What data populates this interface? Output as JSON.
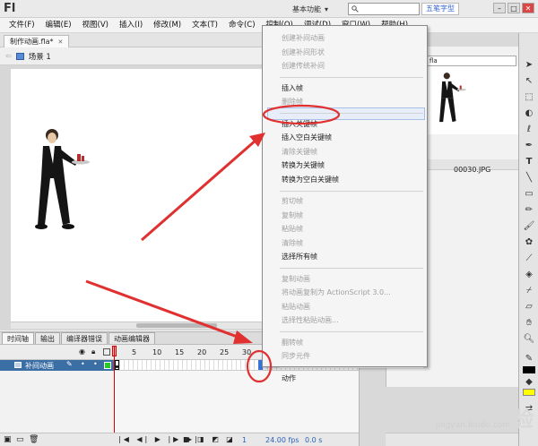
{
  "app": {
    "logo": "Fl"
  },
  "titlebar": {
    "workspace": "基本功能",
    "search_placeholder": "",
    "extra_label": "五笔字型"
  },
  "menu": [
    "文件(F)",
    "编辑(E)",
    "视图(V)",
    "插入(I)",
    "修改(M)",
    "文本(T)",
    "命令(C)",
    "控制(O)",
    "调试(D)",
    "窗口(W)",
    "帮助(H)"
  ],
  "document": {
    "tab_title": "制作动画.fla*",
    "scene": "场景 1"
  },
  "timeline": {
    "tabs": [
      "时间轴",
      "输出",
      "编译器错误",
      "动画编辑器"
    ],
    "layer_name": "补间动画",
    "frame_numbers": [
      "5",
      "10",
      "15",
      "20",
      "25",
      "30"
    ],
    "current_frame": "1",
    "fps": "24.00 fps",
    "time": "0.0 s"
  },
  "library": {
    "dropdown": "fla",
    "item": "00030.JPG"
  },
  "context_menu": {
    "groups": [
      [
        {
          "label": "创建补间动画",
          "enabled": false
        },
        {
          "label": "创建补间形状",
          "enabled": false
        },
        {
          "label": "创建传统补间",
          "enabled": false
        }
      ],
      [
        {
          "label": "插入帧",
          "enabled": true
        },
        {
          "label": "删除帧",
          "enabled": false
        }
      ],
      [
        {
          "label": "插入关键帧",
          "enabled": true
        },
        {
          "label": "插入空白关键帧",
          "enabled": true
        },
        {
          "label": "清除关键帧",
          "enabled": false
        },
        {
          "label": "转换为关键帧",
          "enabled": true
        },
        {
          "label": "转换为空白关键帧",
          "enabled": true
        }
      ],
      [
        {
          "label": "剪切帧",
          "enabled": false
        },
        {
          "label": "复制帧",
          "enabled": false
        },
        {
          "label": "粘贴帧",
          "enabled": false
        },
        {
          "label": "清除帧",
          "enabled": false
        },
        {
          "label": "选择所有帧",
          "enabled": true
        }
      ],
      [
        {
          "label": "复制动画",
          "enabled": false
        },
        {
          "label": "将动画复制为 ActionScript 3.0...",
          "enabled": false
        },
        {
          "label": "粘贴动画",
          "enabled": false
        },
        {
          "label": "选择性粘贴动画...",
          "enabled": false
        }
      ],
      [
        {
          "label": "翻转帧",
          "enabled": false
        },
        {
          "label": "同步元件",
          "enabled": false
        }
      ],
      [
        {
          "label": "动作",
          "enabled": true
        }
      ]
    ],
    "highlighted": "插入关键帧"
  },
  "watermark": {
    "brand": "Baidu经验",
    "url": "jingyan.baidu.com"
  },
  "colors": {
    "annotation": "#e03030",
    "selection": "#3a6ea5",
    "playhead": "#dd0000"
  }
}
